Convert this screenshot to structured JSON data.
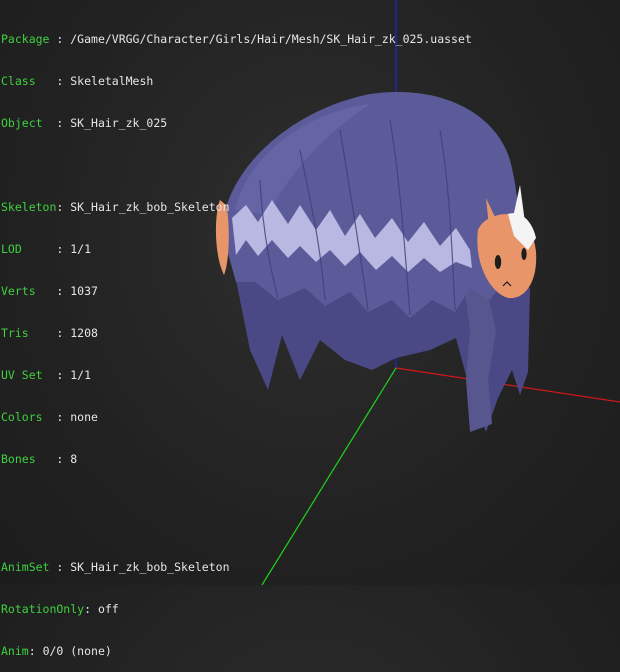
{
  "info": [
    {
      "key": "Package ",
      "sep": ": ",
      "value": "/Game/VRGG/Character/Girls/Hair/Mesh/SK_Hair_zk_025.uasset"
    },
    {
      "key": "Class   ",
      "sep": ": ",
      "value": "SkeletalMesh"
    },
    {
      "key": "Object  ",
      "sep": ": ",
      "value": "SK_Hair_zk_025"
    }
  ],
  "mesh": [
    {
      "key": "Skeleton",
      "sep": ": ",
      "value": "SK_Hair_zk_bob_Skeleton"
    },
    {
      "key": "LOD     ",
      "sep": ": ",
      "value": "1/1"
    },
    {
      "key": "Verts   ",
      "sep": ": ",
      "value": "1037"
    },
    {
      "key": "Tris    ",
      "sep": ": ",
      "value": "1208"
    },
    {
      "key": "UV Set  ",
      "sep": ": ",
      "value": "1/1"
    },
    {
      "key": "Colors  ",
      "sep": ": ",
      "value": "none"
    },
    {
      "key": "Bones   ",
      "sep": ": ",
      "value": "8"
    }
  ],
  "anim": [
    {
      "key": "AnimSet ",
      "sep": ": ",
      "value": "SK_Hair_zk_bob_Skeleton"
    },
    {
      "key": "RotationOnly",
      "sep": ": ",
      "value": "off"
    },
    {
      "key": "Anim",
      "sep": ": ",
      "value": "0/0 (none)"
    }
  ],
  "colors": {
    "label": "#3fd13f",
    "value": "#e6e6e6",
    "axis_x": "#d01818",
    "axis_y": "#1fd11f",
    "axis_z": "#2222dd",
    "hair": "#5c5b9a",
    "hair_highlight": "#c9c9ef",
    "clip_skin": "#e8956a"
  },
  "viewport": {
    "content": "SkeletalMesh preview of hair model with coordinate axes"
  }
}
